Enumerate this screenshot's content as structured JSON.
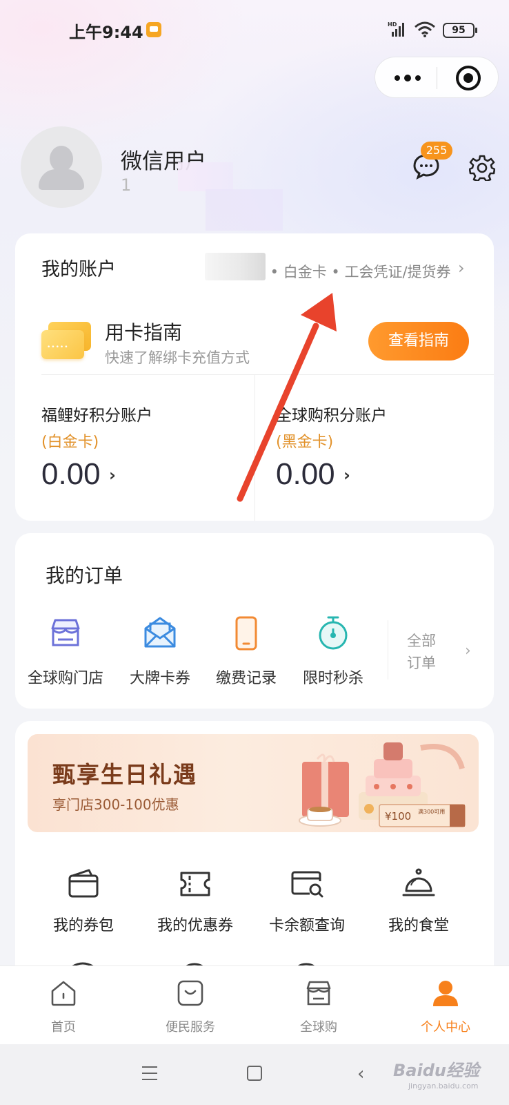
{
  "status_bar": {
    "time": "上午9:44",
    "battery": "95",
    "network": "HD"
  },
  "profile": {
    "name": "微信用户",
    "phone_partial": "1",
    "message_badge": "255"
  },
  "account": {
    "title": "我的账户",
    "card_types": "福礼卡 • 白金卡 • 工会凭证/提货券",
    "chevron": "›",
    "guide": {
      "title": "用卡指南",
      "subtitle": "快速了解绑卡充值方式",
      "button": "查看指南"
    },
    "points": [
      {
        "name": "福鲤好积分账户",
        "level": "(白金卡)",
        "value": "0.00"
      },
      {
        "name": "全球购积分账户",
        "level": "(黑金卡)",
        "value": "0.00"
      }
    ]
  },
  "orders": {
    "title": "我的订单",
    "items": [
      {
        "label": "全球购门店",
        "icon": "store-icon"
      },
      {
        "label": "大牌卡券",
        "icon": "envelope-icon"
      },
      {
        "label": "缴费记录",
        "icon": "phone-icon"
      },
      {
        "label": "限时秒杀",
        "icon": "stopwatch-icon"
      }
    ],
    "all_label": "全部订单"
  },
  "banner": {
    "title": "甄享生日礼遇",
    "subtitle": "享门店300-100优惠",
    "voucher_amount": "¥100",
    "voucher_text": "满300可用"
  },
  "services": {
    "items": [
      {
        "label": "我的券包",
        "icon": "wallet-icon"
      },
      {
        "label": "我的优惠券",
        "icon": "ticket-icon"
      },
      {
        "label": "卡余额查询",
        "icon": "card-search-icon"
      },
      {
        "label": "我的食堂",
        "icon": "cloche-icon"
      }
    ]
  },
  "tab_bar": {
    "items": [
      {
        "label": "首页",
        "icon": "home-icon",
        "active": false
      },
      {
        "label": "便民服务",
        "icon": "bag-icon",
        "active": false
      },
      {
        "label": "全球购",
        "icon": "shop-icon",
        "active": false
      },
      {
        "label": "个人中心",
        "icon": "person-icon",
        "active": true
      }
    ]
  },
  "watermark": {
    "brand": "Baidu经验",
    "url": "jingyan.baidu.com"
  },
  "colors": {
    "accent": "#f7801b",
    "button_gradient_start": "#ff9a2e",
    "button_gradient_end": "#fb7c13",
    "level_text": "#e2922b",
    "arrow": "#e8432c"
  }
}
